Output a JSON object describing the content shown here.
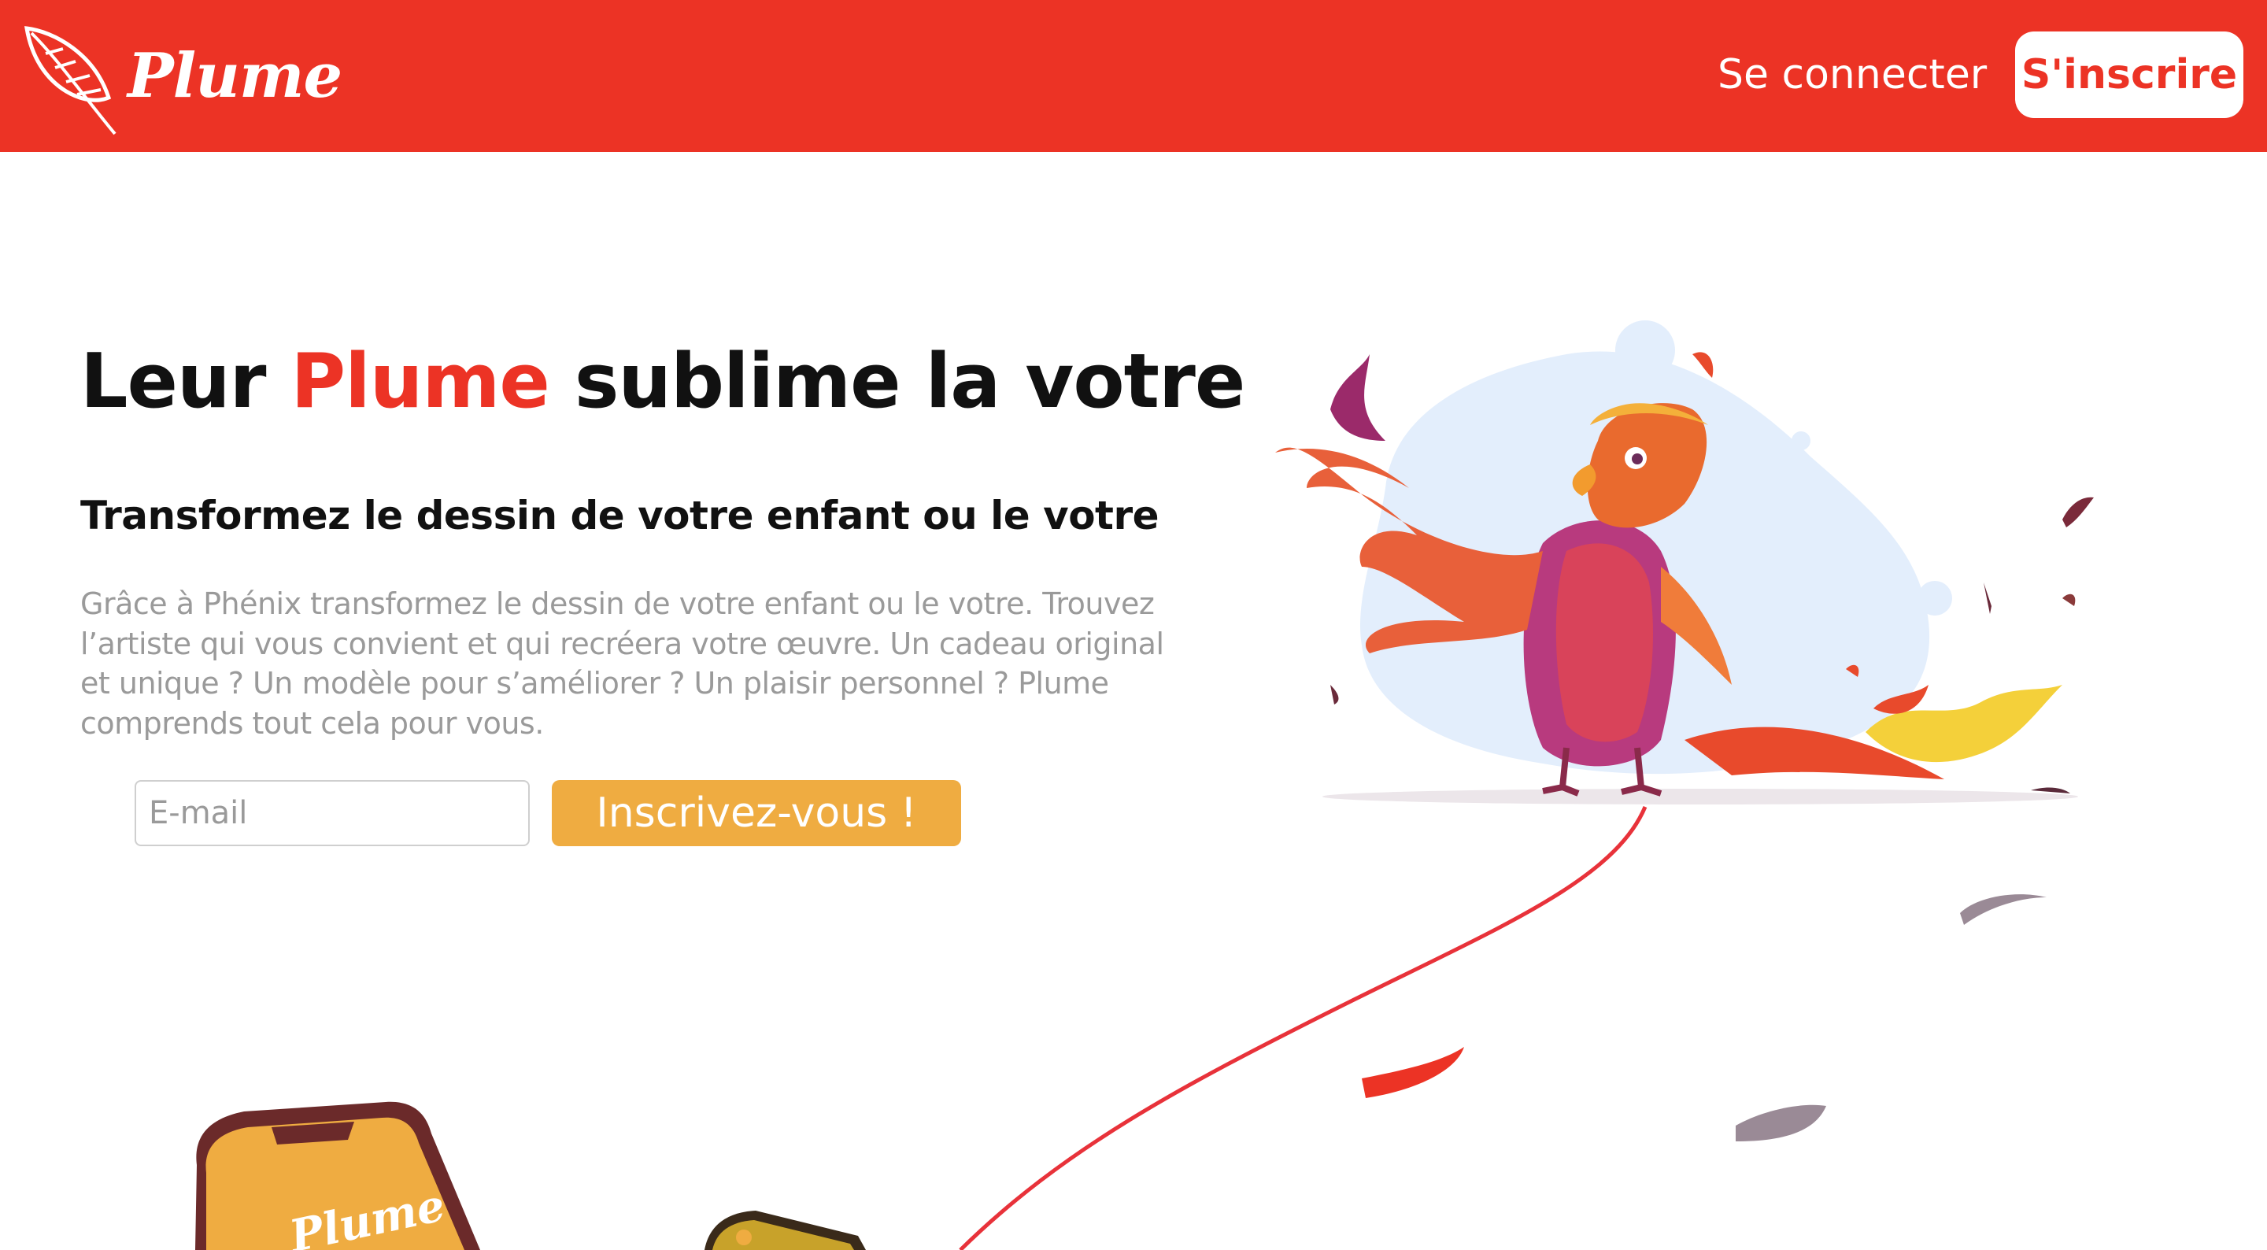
{
  "header": {
    "logo_text": "Plume",
    "login_label": "Se connecter",
    "signup_label": "S'inscrire"
  },
  "hero": {
    "title_before": "Leur ",
    "title_accent": "Plume",
    "title_after": " sublime la votre",
    "subtitle": "Transformez le dessin de votre enfant ou le votre",
    "body": "Grâce à Phénix transformez le dessin de votre enfant ou le votre. Trouvez l’artiste qui vous convient et qui recréera votre œuvre. Un cadeau original et unique ? Un modèle pour s’améliorer ? Un plaisir personnel ? Plume comprends tout cela pour vous."
  },
  "signup_form": {
    "email_placeholder": "E-mail",
    "email_value": "",
    "submit_label": "Inscrivez-vous !"
  },
  "phone_screen_text": "Plume",
  "colors": {
    "brand_red": "#ec3325",
    "cta_orange": "#efac41",
    "muted_text": "#9a9a9a",
    "phone_screen": "#efac41"
  },
  "icons": {
    "logo": "feather-icon",
    "illustration": "phoenix-illustration"
  }
}
